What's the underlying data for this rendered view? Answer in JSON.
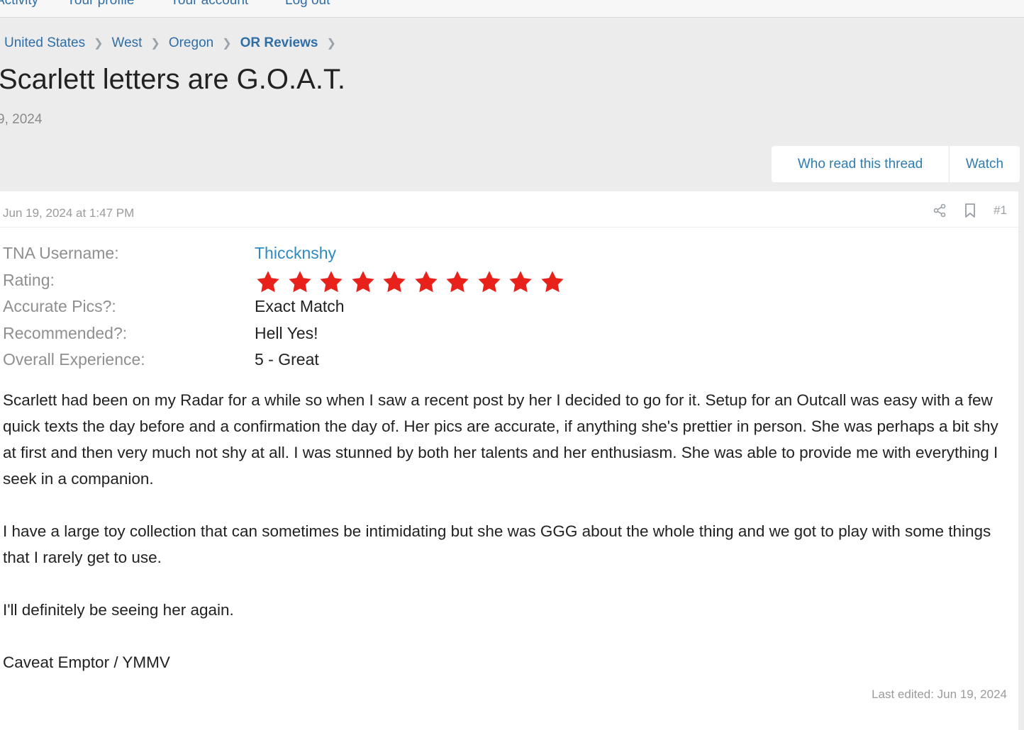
{
  "nav": {
    "items": [
      "Activity",
      "Your profile",
      "Your account",
      "Log out"
    ]
  },
  "breadcrumb": {
    "items": [
      "United States",
      "West",
      "Oregon",
      "OR Reviews"
    ]
  },
  "thread": {
    "title": "Scarlett letters are G.O.A.T.",
    "date": "9, 2024",
    "who_read_label": "Who read this thread",
    "watch_label": "Watch"
  },
  "post": {
    "timestamp": "Jun 19, 2024 at 1:47 PM",
    "number": "#1",
    "fields": [
      {
        "label": "TNA Username:",
        "value": "Thiccknshy"
      },
      {
        "label": "Rating:",
        "value": "10 stars"
      },
      {
        "label": "Accurate Pics?:",
        "value": "Exact Match"
      },
      {
        "label": "Recommended?:",
        "value": "Hell Yes!"
      },
      {
        "label": "Overall Experience:",
        "value": "5 - Great"
      }
    ],
    "rating_stars": 10,
    "star_color": "#e8221a",
    "paragraphs": [
      "Scarlett had been on my Radar for a while so when I saw a recent post by her I decided to go for it. Setup for an Outcall was easy with a few quick texts the day before and a confirmation the day of. Her pics are accurate, if anything she's prettier in person. She was perhaps a bit shy at first and then very much not shy at all. I was stunned by both her talents and her enthusiasm. She was able to provide me with everything I seek in a companion.",
      "I have a large toy collection that can sometimes be intimidating but she was GGG about the whole thing and we got to play with some things that I rarely get to use.",
      "I'll definitely be seeing her again.",
      "Caveat Emptor / YMMV"
    ],
    "last_edited": "Last edited: Jun 19, 2024"
  },
  "icons": {
    "share": "share-icon",
    "bookmark": "bookmark-icon",
    "star": "star-icon",
    "chevron": "chevron-right-icon"
  },
  "colors": {
    "link": "#2f6ea6",
    "accent": "#2f8ac3",
    "background": "#ececec"
  }
}
